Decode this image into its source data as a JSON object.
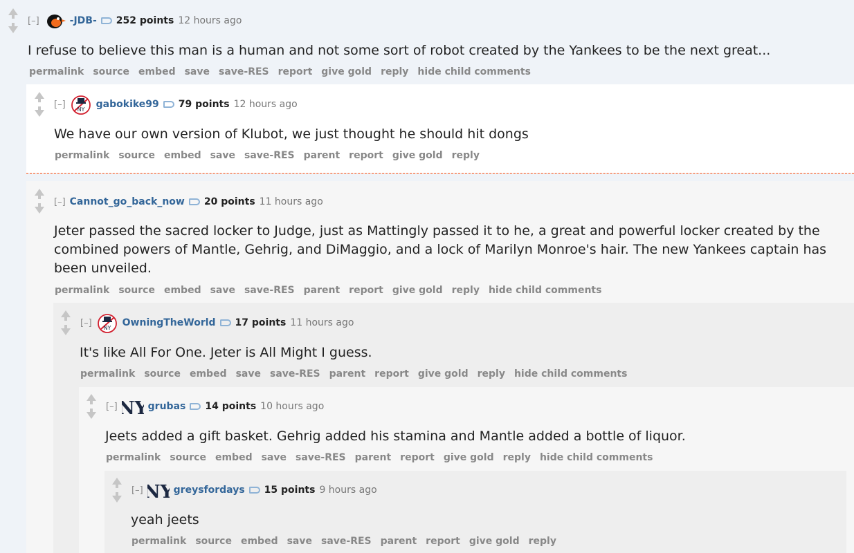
{
  "comments": [
    {
      "expand": "[–]",
      "author": "-JDB-",
      "avatar_icon": "orioles-bird-icon",
      "score": "252 points",
      "time": "12 hours ago",
      "body": "I refuse to believe this man is a human and not some sort of robot created by the Yankees to be the next great...",
      "buttons": [
        "permalink",
        "source",
        "embed",
        "save",
        "save-RES",
        "report",
        "give gold",
        "reply",
        "hide child comments"
      ]
    },
    {
      "expand": "[–]",
      "author": "gabokike99",
      "avatar_icon": "yankees-top-hat-icon",
      "score": "79 points",
      "time": "12 hours ago",
      "body": "We have our own version of Klubot, we just thought he should hit dongs",
      "buttons": [
        "permalink",
        "source",
        "embed",
        "save",
        "save-RES",
        "parent",
        "report",
        "give gold",
        "reply"
      ]
    },
    {
      "expand": "[–]",
      "author": "Cannot_go_back_now",
      "score": "20 points",
      "time": "11 hours ago",
      "body_lines": [
        "Jeter passed the sacred locker to Judge, just as Mattingly passed it to he, a great and powerful locker created by the",
        "combined powers of Mantle, Gehrig, and DiMaggio, and a lock of Marilyn Monroe's hair. The new Yankees captain has",
        "been unveiled."
      ],
      "buttons": [
        "permalink",
        "source",
        "embed",
        "save",
        "save-RES",
        "parent",
        "report",
        "give gold",
        "reply",
        "hide child comments"
      ]
    },
    {
      "expand": "[–]",
      "author": "OwningTheWorld",
      "avatar_icon": "yankees-top-hat-icon",
      "score": "17 points",
      "time": "11 hours ago",
      "body": "It's like All For One. Jeter is All Might I guess.",
      "buttons": [
        "permalink",
        "source",
        "embed",
        "save",
        "save-RES",
        "parent",
        "report",
        "give gold",
        "reply",
        "hide child comments"
      ]
    },
    {
      "expand": "[–]",
      "author": "grubas",
      "avatar_icon": "ny-logo-icon",
      "score": "14 points",
      "time": "10 hours ago",
      "body": "Jeets added a gift basket. Gehrig added his stamina and Mantle added a bottle of liquor.",
      "buttons": [
        "permalink",
        "source",
        "embed",
        "save",
        "save-RES",
        "parent",
        "report",
        "give gold",
        "reply",
        "hide child comments"
      ]
    },
    {
      "expand": "[–]",
      "author": "greysfordays",
      "avatar_icon": "ny-logo-icon",
      "score": "15 points",
      "time": "9 hours ago",
      "body": "yeah jeets",
      "buttons": [
        "permalink",
        "source",
        "embed",
        "save",
        "save-RES",
        "parent",
        "report",
        "give gold",
        "reply"
      ]
    }
  ],
  "colors": {
    "author": "#336699",
    "divider": "#ff4500",
    "button_text": "#888888"
  }
}
